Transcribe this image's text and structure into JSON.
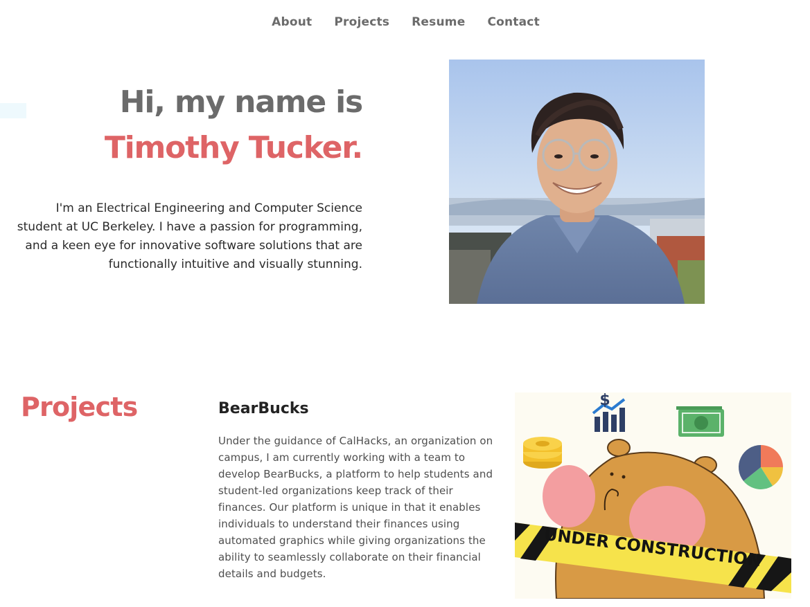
{
  "nav": {
    "items": [
      {
        "label": "About"
      },
      {
        "label": "Projects"
      },
      {
        "label": "Resume"
      },
      {
        "label": "Contact"
      }
    ]
  },
  "hero": {
    "greeting": "Hi, my name is",
    "name": "Timothy Tucker.",
    "bio": "I'm an Electrical Engineering and Computer Science student at UC Berkeley. I have a passion for programming, and a keen eye for innovative software solutions that are functionally intuitive and visually stunning."
  },
  "projects": {
    "heading": "Projects",
    "items": [
      {
        "title": "BearBucks",
        "description": "Under the guidance of CalHacks, an organization on campus, I am currently working with a team to develop BearBucks, a platform to help students and student-led organizations keep track of their finances. Our platform is unique in that it enables individuals to understand their finances using automated graphics while giving organizations the ability to seamlessly collaborate on their financial details and budgets.",
        "image_banner": "UNDER CONSTRUCTION",
        "image_symbol": "$"
      }
    ]
  },
  "colors": {
    "accent": "#de6466",
    "nav_text": "#6b6b6b",
    "heading_gray": "#6b6b6b",
    "body_text": "#2a2a2a"
  }
}
